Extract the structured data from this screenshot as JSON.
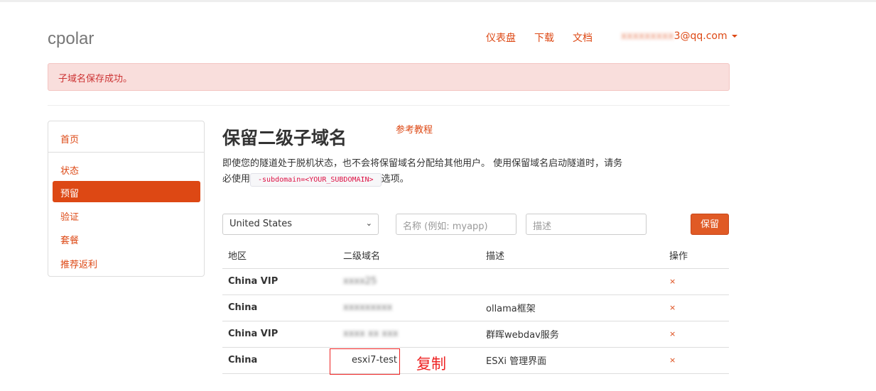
{
  "logo": "cpolar",
  "nav": {
    "dashboard": "仪表盘",
    "download": "下载",
    "docs": "文档",
    "email_hidden": "xxxxxxxxx",
    "email_suffix": "3@qq.com"
  },
  "alert": "子域名保存成功。",
  "sidebar": [
    "首页",
    "状态",
    "预留",
    "验证",
    "套餐",
    "推荐返利"
  ],
  "title": "保留二级子域名",
  "ref_link": "参考教程",
  "desc1": "即使您的隧道处于脱机状态，也不会将保留域名分配给其他用户。 使用保留域名启动隧道时，请务必使用",
  "code": "-subdomain=<YOUR_SUBDOMAIN>",
  "desc2": "选项。",
  "form": {
    "region": "United States",
    "name_placeholder": "名称 (例如: myapp)",
    "desc_placeholder": "描述",
    "submit": "保留"
  },
  "table": {
    "headers": [
      "地区",
      "二级域名",
      "描述",
      "操作"
    ],
    "rows": [
      {
        "region": "China VIP",
        "subdomain": "xxxx25",
        "desc": "",
        "op": "×"
      },
      {
        "region": "China",
        "subdomain": "xxxxxxxxx",
        "desc": "ollama框架",
        "op": "×"
      },
      {
        "region": "China VIP",
        "subdomain": "xxxx xx xxx",
        "desc": "群晖webdav服务",
        "op": "×"
      },
      {
        "region": "China",
        "subdomain": "esxi7-test",
        "desc": "ESXi 管理界面",
        "op": "×"
      }
    ]
  },
  "annotation": "复制"
}
